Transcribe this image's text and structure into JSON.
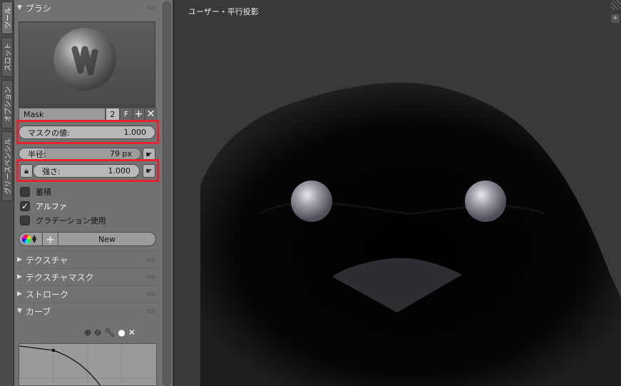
{
  "tabs": [
    {
      "label": "ツール",
      "active": true
    },
    {
      "label": "スロット",
      "active": false
    },
    {
      "label": "オプション",
      "active": false
    },
    {
      "label": "グリースペンシル",
      "active": false
    }
  ],
  "brush_panel": {
    "title": "ブラシ",
    "brush_name": "Mask",
    "users": "2",
    "fake_user": "F",
    "add_icon": "plus-icon",
    "remove_icon": "close-icon"
  },
  "mask_value": {
    "label": "マスクの値:",
    "value": "1.000",
    "fraction": 1.0
  },
  "radius": {
    "label": "半径:",
    "value": "79 px"
  },
  "strength": {
    "label": "強さ:",
    "value": "1.000",
    "fraction": 1.0
  },
  "checks": [
    {
      "label": "蓄積",
      "checked": false
    },
    {
      "label": "アルファ",
      "checked": true
    },
    {
      "label": "グラデーション使用",
      "checked": false
    }
  ],
  "texture_new": {
    "new_label": "New"
  },
  "sections": [
    {
      "label": "テクスチャ",
      "expanded": false
    },
    {
      "label": "テクスチャマスク",
      "expanded": false
    },
    {
      "label": "ストローク",
      "expanded": false
    },
    {
      "label": "カーブ",
      "expanded": true
    }
  ],
  "curve_tools": [
    "zoom-in-icon",
    "zoom-out-icon",
    "wrench-icon",
    "dot-icon",
    "close-icon"
  ],
  "viewport": {
    "label": "ユーザー・平行投影",
    "corner_icon": "plus-icon"
  },
  "colors": {
    "highlight": "#e3232d",
    "panel": "#727272",
    "viewport": "#393939"
  }
}
